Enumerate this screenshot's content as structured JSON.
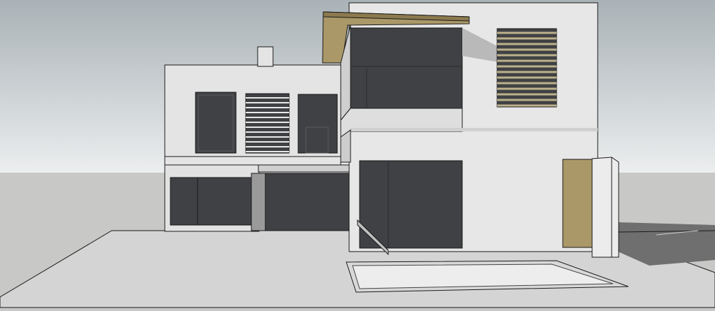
{
  "scene": {
    "description_type": "3d-architectural-model-render",
    "colors": {
      "sky_top": "#a9b2b6",
      "sky_bottom": "#eceeef",
      "ground": "#c8c8c6",
      "wall": "#e7e7e7",
      "wall_shade": "#d6d6d6",
      "glass": "#3f4144",
      "shadow": "#7b7b7b",
      "wood": "#aa9868",
      "wood_dark": "#8c7a4f",
      "outline": "#1a1a1a"
    }
  }
}
